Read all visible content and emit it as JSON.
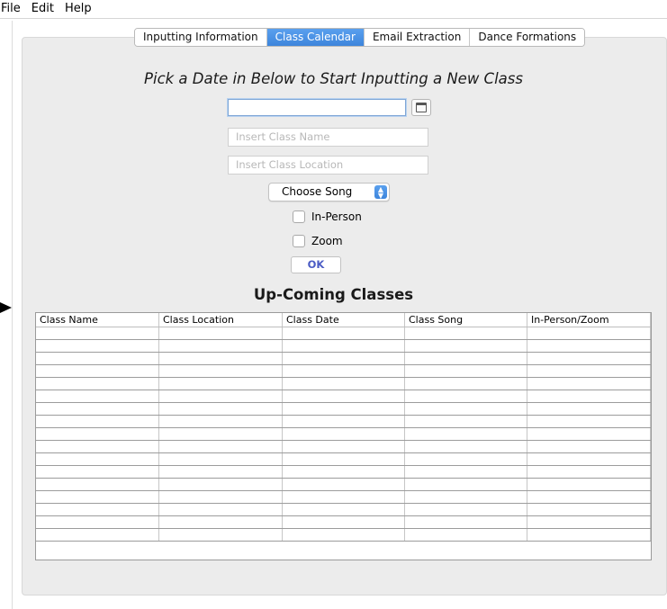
{
  "menubar": {
    "items": [
      "File",
      "Edit",
      "Help"
    ]
  },
  "tabs": [
    {
      "label": "Inputting Information",
      "active": false
    },
    {
      "label": "Class Calendar",
      "active": true
    },
    {
      "label": "Email Extraction",
      "active": false
    },
    {
      "label": "Dance Formations",
      "active": false
    }
  ],
  "form": {
    "heading": "Pick a Date in Below to Start Inputting a New Class",
    "date_value": "",
    "class_name_placeholder": "Insert Class Name",
    "class_location_placeholder": "Insert Class Location",
    "song_select": "Choose Song",
    "in_person_label": "In-Person",
    "zoom_label": "Zoom",
    "ok_label": "OK"
  },
  "table": {
    "title": "Up-Coming Classes",
    "columns": [
      "Class Name",
      "Class Location",
      "Class Date",
      "Class Song",
      "In-Person/Zoom"
    ],
    "rows": [
      [
        "",
        "",
        "",
        "",
        ""
      ],
      [
        "",
        "",
        "",
        "",
        ""
      ],
      [
        "",
        "",
        "",
        "",
        ""
      ],
      [
        "",
        "",
        "",
        "",
        ""
      ],
      [
        "",
        "",
        "",
        "",
        ""
      ],
      [
        "",
        "",
        "",
        "",
        ""
      ],
      [
        "",
        "",
        "",
        "",
        ""
      ],
      [
        "",
        "",
        "",
        "",
        ""
      ],
      [
        "",
        "",
        "",
        "",
        ""
      ],
      [
        "",
        "",
        "",
        "",
        ""
      ],
      [
        "",
        "",
        "",
        "",
        ""
      ],
      [
        "",
        "",
        "",
        "",
        ""
      ],
      [
        "",
        "",
        "",
        "",
        ""
      ],
      [
        "",
        "",
        "",
        "",
        ""
      ],
      [
        "",
        "",
        "",
        "",
        ""
      ],
      [
        "",
        "",
        "",
        "",
        ""
      ],
      [
        "",
        "",
        "",
        "",
        ""
      ]
    ]
  },
  "icons": {
    "calendar": "calendar-icon",
    "select_arrows": "chevron-updown-icon",
    "pointer": "arrow-right-icon"
  },
  "colors": {
    "accent": "#4a90e2",
    "ok_text": "#4a5bc4"
  }
}
